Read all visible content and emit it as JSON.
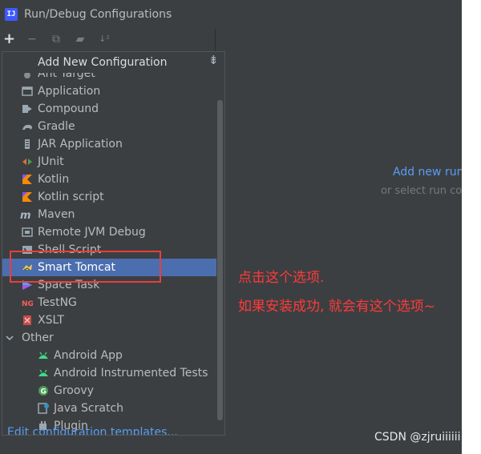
{
  "window": {
    "title": "Run/Debug Configurations",
    "app_icon_text": "IJ"
  },
  "toolbar": {
    "add": "+",
    "remove": "−",
    "copy": "⧉",
    "folder": "▰",
    "sort": "↓²"
  },
  "popup": {
    "title": "Add New Configuration",
    "collapse_glyph": "⇟",
    "items": [
      {
        "label": "Ant Target",
        "icon": "ant-icon"
      },
      {
        "label": "Application",
        "icon": "application-icon"
      },
      {
        "label": "Compound",
        "icon": "compound-icon"
      },
      {
        "label": "Gradle",
        "icon": "gradle-icon"
      },
      {
        "label": "JAR Application",
        "icon": "jar-icon"
      },
      {
        "label": "JUnit",
        "icon": "junit-icon"
      },
      {
        "label": "Kotlin",
        "icon": "kotlin-icon"
      },
      {
        "label": "Kotlin script",
        "icon": "kotlin-script-icon"
      },
      {
        "label": "Maven",
        "icon": "maven-icon"
      },
      {
        "label": "Remote JVM Debug",
        "icon": "remote-debug-icon"
      },
      {
        "label": "Shell Script",
        "icon": "shell-script-icon"
      },
      {
        "label": "Smart Tomcat",
        "icon": "tomcat-icon"
      },
      {
        "label": "Space Task",
        "icon": "space-icon"
      },
      {
        "label": "TestNG",
        "icon": "testng-icon"
      },
      {
        "label": "XSLT",
        "icon": "xslt-icon"
      }
    ],
    "group": {
      "label": "Other",
      "expanded": true
    },
    "other_items": [
      {
        "label": "Android App",
        "icon": "android-icon"
      },
      {
        "label": "Android Instrumented Tests",
        "icon": "android-tests-icon"
      },
      {
        "label": "Groovy",
        "icon": "groovy-icon"
      },
      {
        "label": "Java Scratch",
        "icon": "java-scratch-icon"
      },
      {
        "label": "Plugin",
        "icon": "plugin-icon"
      }
    ],
    "footer_link": "Edit configuration templates..."
  },
  "right_panel": {
    "link": "Add new run",
    "sub": "or select run co"
  },
  "annotations": {
    "line1": "点击这个选项.",
    "line2": "如果安装成功, 就会有这个选项~"
  },
  "watermark": "CSDN @zjruiiiiii",
  "colors": {
    "accent": "#589df6",
    "selection": "#4b6eaf",
    "annotation": "#ff3a3a"
  }
}
